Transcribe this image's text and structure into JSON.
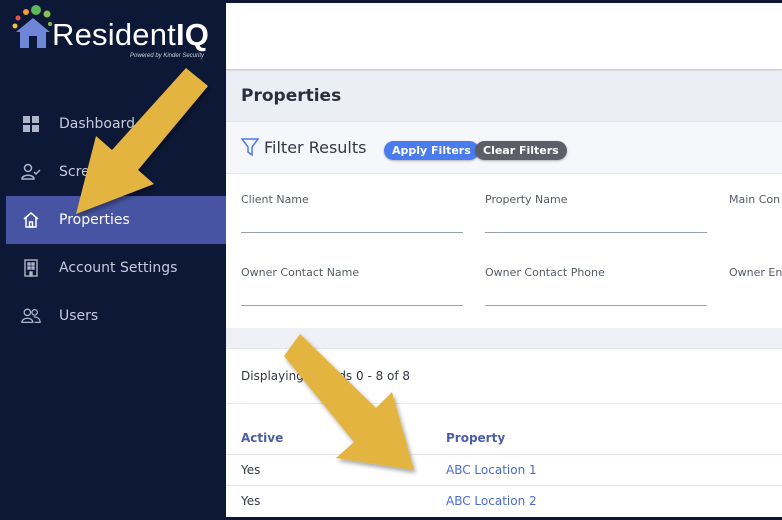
{
  "brand": {
    "name_main": "Resident",
    "name_accent": "IQ",
    "tagline": "Powered by Kinder Security"
  },
  "sidebar": {
    "items": [
      {
        "label": "Dashboard",
        "icon": "grid-icon",
        "active": false
      },
      {
        "label": "Screenings",
        "icon": "user-check-icon",
        "active": false
      },
      {
        "label": "Properties",
        "icon": "home-icon",
        "active": true
      },
      {
        "label": "Account Settings",
        "icon": "building-icon",
        "active": false
      },
      {
        "label": "Users",
        "icon": "users-icon",
        "active": false
      }
    ]
  },
  "page": {
    "title": "Properties"
  },
  "filters": {
    "title": "Filter Results",
    "apply_label": "Apply Filters",
    "clear_label": "Clear Filters",
    "fields": {
      "client_name": "Client Name",
      "property_name": "Property Name",
      "main_contact": "Main Con",
      "owner_contact_name": "Owner Contact Name",
      "owner_contact_phone": "Owner Contact Phone",
      "owner_email": "Owner En"
    }
  },
  "records": {
    "text": "Displaying records 0 - 8 of 8"
  },
  "table": {
    "columns": [
      "Active",
      "Property"
    ],
    "rows": [
      {
        "active": "Yes",
        "property": "ABC Location 1"
      },
      {
        "active": "Yes",
        "property": "ABC Location 2"
      }
    ]
  },
  "colors": {
    "sidebar_bg": "#0d1836",
    "active_nav": "#4654a3",
    "apply_button": "#4a7cf0",
    "clear_button": "#5c5f68",
    "annotation_arrow": "#e3b53f",
    "link": "#4a6cd6"
  }
}
